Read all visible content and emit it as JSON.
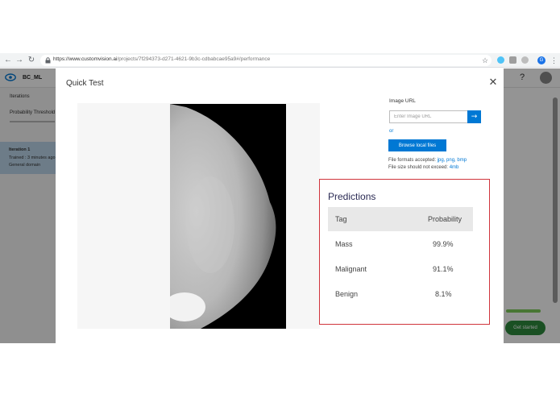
{
  "browser": {
    "url_main": "https://www.customvision.ai",
    "url_path": "/projects/7f294373-d271-4621-9b3c-cdbabcae95a9#/performance",
    "profile_initial": "G"
  },
  "app": {
    "project_name": "BC_ML",
    "help_label": "?",
    "sidebar": {
      "iterations_label": "Iterations",
      "probability_label": "Probability Threshold",
      "iteration_title": "Iteration 1",
      "iteration_trained": "Trained : 3 minutes ago",
      "iteration_domain": "General domain"
    },
    "get_started_label": "Get started"
  },
  "modal": {
    "title": "Quick Test",
    "close_label": "✕",
    "image_url_label": "Image URL",
    "image_url_placeholder": "Enter Image URL",
    "go_label": "→",
    "or_label": "or",
    "browse_label": "Browse local files",
    "formats_prefix": "File formats accepted: ",
    "formats_list": "jpg, png, bmp",
    "size_prefix": "File size should not exceed: ",
    "size_limit": "4mb"
  },
  "predictions": {
    "title": "Predictions",
    "col_tag": "Tag",
    "col_probability": "Probability",
    "rows": [
      {
        "tag": "Mass",
        "probability": "99.9%"
      },
      {
        "tag": "Malignant",
        "probability": "91.1%"
      },
      {
        "tag": "Benign",
        "probability": "8.1%"
      }
    ]
  },
  "colors": {
    "accent": "#0078d4",
    "highlight_border": "#d0343c",
    "get_started": "#2e8b3d"
  }
}
